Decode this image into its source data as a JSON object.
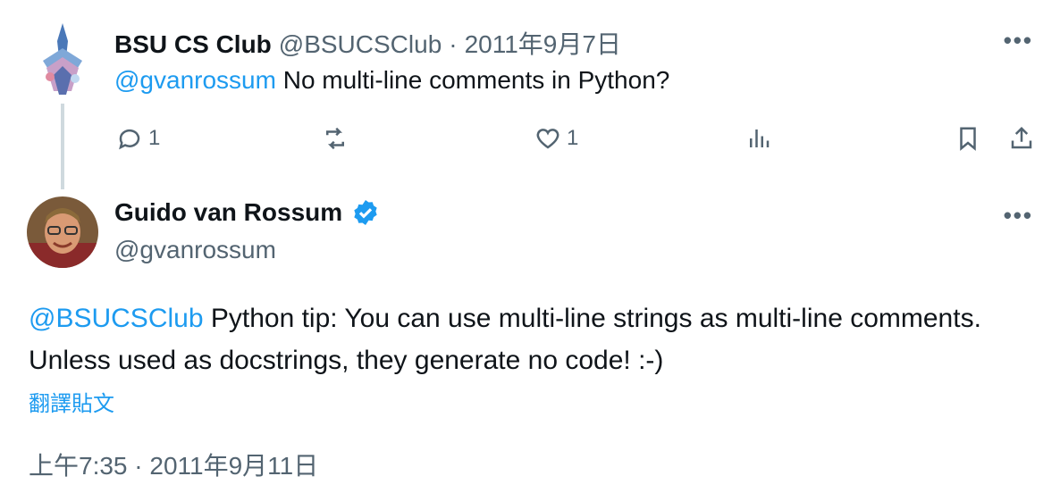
{
  "reply_to": {
    "name": "BSU CS Club",
    "handle": "@BSUCSClub",
    "sep": "·",
    "date": "2011年9月7日",
    "mention": "@gvanrossum",
    "text": " No multi-line comments in Python?",
    "actions": {
      "reply_count": "1",
      "retweet_count": "",
      "like_count": "1"
    }
  },
  "main_tweet": {
    "name": "Guido van Rossum",
    "handle": "@gvanrossum",
    "mention": "@BSUCSClub",
    "text": " Python tip: You can use multi-line strings as multi-line comments. Unless used as docstrings, they generate no code! :-)",
    "translate": "翻譯貼文",
    "timestamp": "上午7:35 · 2011年9月11日"
  },
  "icons": {
    "more": "more-icon",
    "reply": "reply-icon",
    "retweet": "retweet-icon",
    "like": "like-icon",
    "views": "views-icon",
    "bookmark": "bookmark-icon",
    "share": "share-icon",
    "verified": "verified-badge-icon"
  },
  "colors": {
    "link": "#1d9bf0",
    "muted": "#536471",
    "verified": "#1d9bf0"
  }
}
